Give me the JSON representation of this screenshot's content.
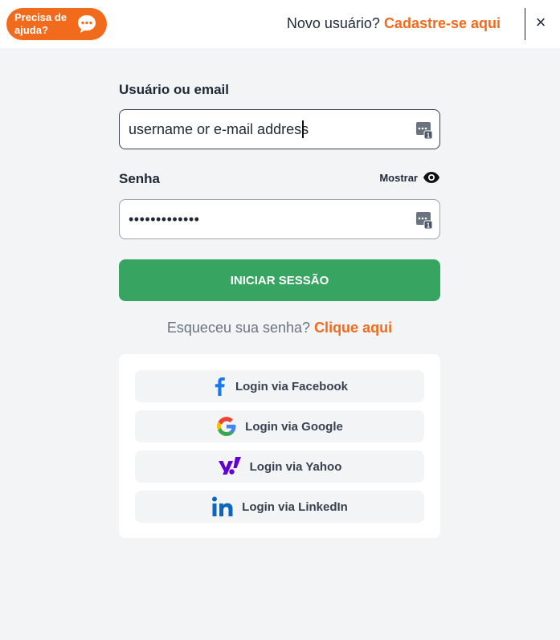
{
  "header": {
    "help_label": "Precisa de ajuda?",
    "new_user_prompt": "Novo usuário?",
    "signup_link": "Cadastre-se aqui",
    "close_symbol": "×"
  },
  "login_form": {
    "username_label": "Usuário ou email",
    "username_placeholder": "username or e-mail address",
    "username_value": "",
    "password_label": "Senha",
    "password_dots": "•••••••••••••",
    "show_password_label": "Mostrar",
    "submit_label": "INICIAR SESSÃO",
    "forgot_prompt": "Esqueceu sua senha?",
    "forgot_link": "Clique aqui"
  },
  "social": {
    "facebook": "Login via Facebook",
    "google": "Login via Google",
    "yahoo": "Login via Yahoo",
    "linkedin": "Login via LinkedIn"
  },
  "colors": {
    "accent_orange": "#f26a1b",
    "submit_green": "#38a461",
    "facebook_blue": "#1877f2",
    "yahoo_purple": "#6001d2",
    "linkedin_blue": "#0a66c2"
  },
  "icons": {
    "help": "chat-bubble-icon",
    "close": "close-icon",
    "field_manager": "password-manager-icon",
    "show_password": "eye-icon",
    "facebook": "facebook-icon",
    "google": "google-icon",
    "yahoo": "yahoo-icon",
    "linkedin": "linkedin-icon"
  }
}
